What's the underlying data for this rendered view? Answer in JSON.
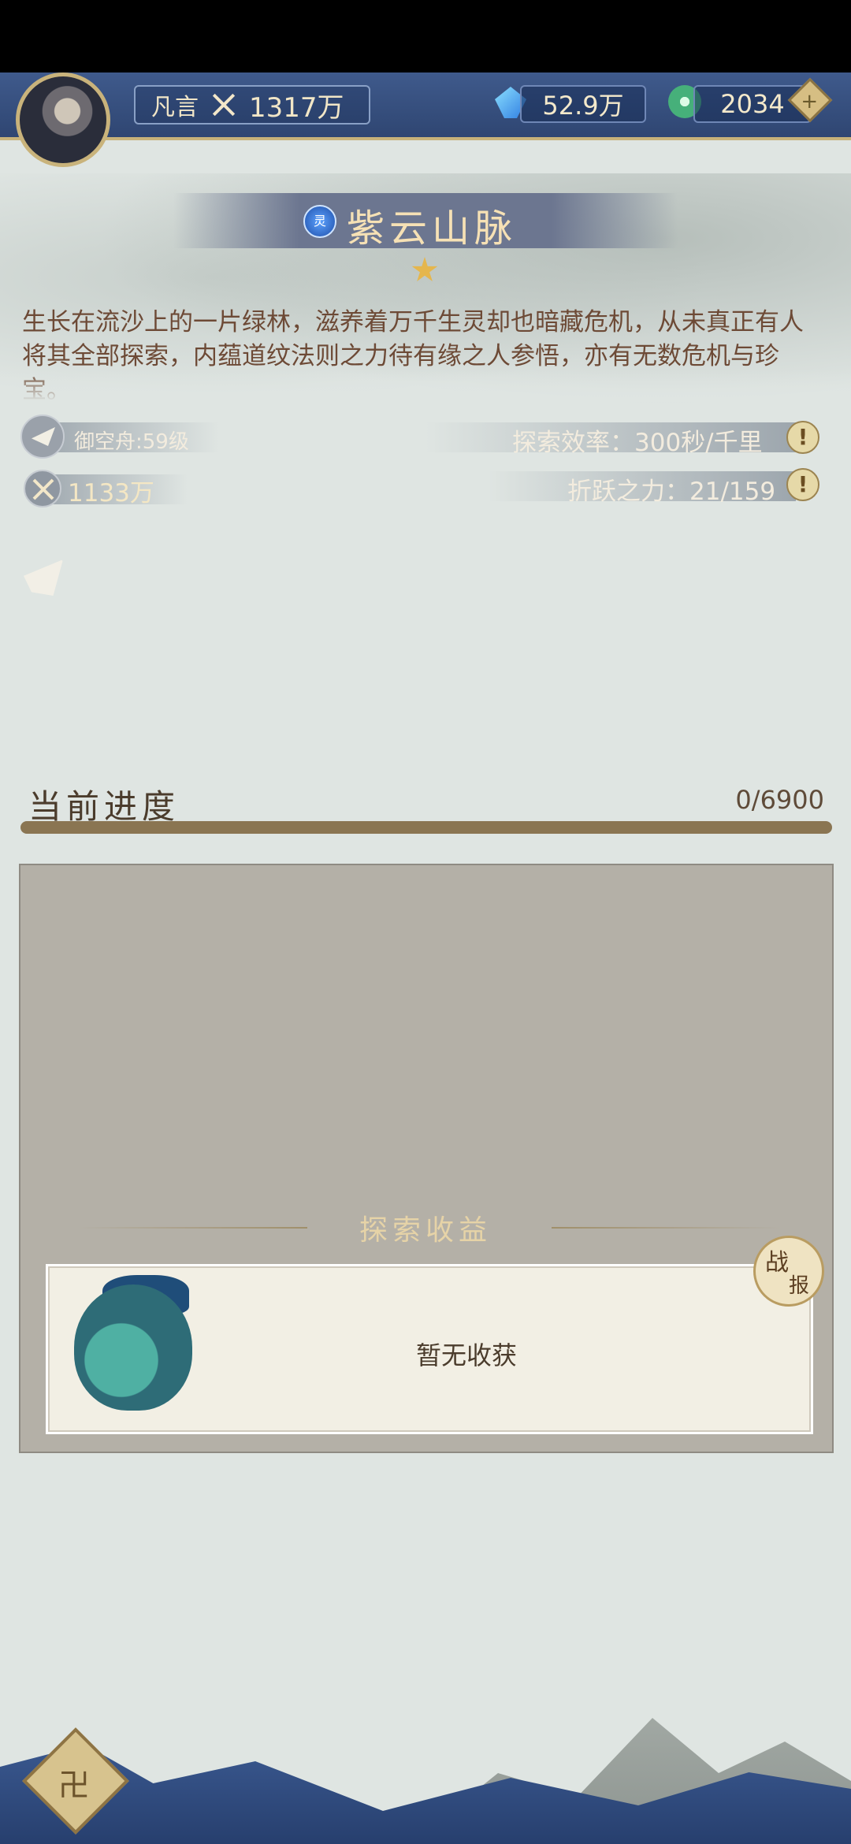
{
  "header": {
    "player_name": "凡言",
    "combat_power": "1317万",
    "resource1": "52.9万",
    "resource2": "2034",
    "add_button": "+"
  },
  "location": {
    "badge": "灵",
    "title": "紫云山脉",
    "stars": 1,
    "description": "生长在流沙上的一片绿林，滋养着万千生灵却也暗藏危机，从未真正有人将其全部探索，内蕴道纹法则之力待有缘之人参悟，亦有无数危机与珍宝。"
  },
  "stats": {
    "vehicle": "御空舟:59级",
    "required_power": "1133万",
    "efficiency": "探索效率：300秒/千里",
    "force": "折跃之力：21/159",
    "info_icon": "!"
  },
  "progress": {
    "label": "当前进度",
    "value": "0/6900",
    "fraction": 0
  },
  "rewards": {
    "title": "探索收益",
    "empty_text": "暂无收获",
    "battle_report_char1": "战",
    "battle_report_char2": "报"
  },
  "home_icon": "卍",
  "colors": {
    "topbar": "#2f4672",
    "accent": "#c9b37b",
    "text": "#6d4a36"
  }
}
